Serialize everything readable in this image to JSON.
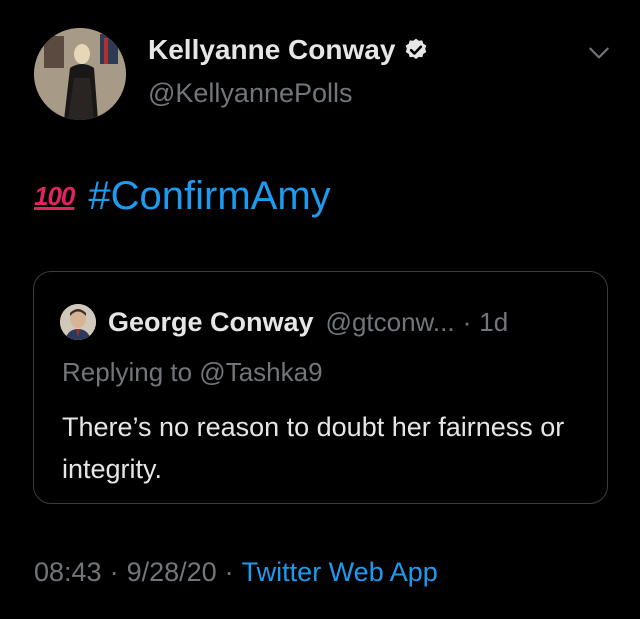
{
  "author": {
    "name": "Kellyanne Conway",
    "handle": "@KellyannePolls",
    "verified": true
  },
  "tweet": {
    "emoji_icon": "hundred-points-icon",
    "hashtag": "#ConfirmAmy"
  },
  "quoted_tweet": {
    "name": "George Conway",
    "handle": "@gtconw...",
    "separator": "·",
    "time": "1d",
    "replying_to": "Replying to @Tashka9",
    "body": "There’s no reason to doubt her fairness or integrity."
  },
  "meta": {
    "time": "08:43",
    "sep1": "·",
    "date": "9/28/20",
    "sep2": "·",
    "source": "Twitter Web App"
  },
  "colors": {
    "background": "#000000",
    "link": "#1d9bf0",
    "muted": "#71767b",
    "text": "#e6e6e6",
    "emoji": "#e0245e",
    "border": "#3a3d40"
  }
}
